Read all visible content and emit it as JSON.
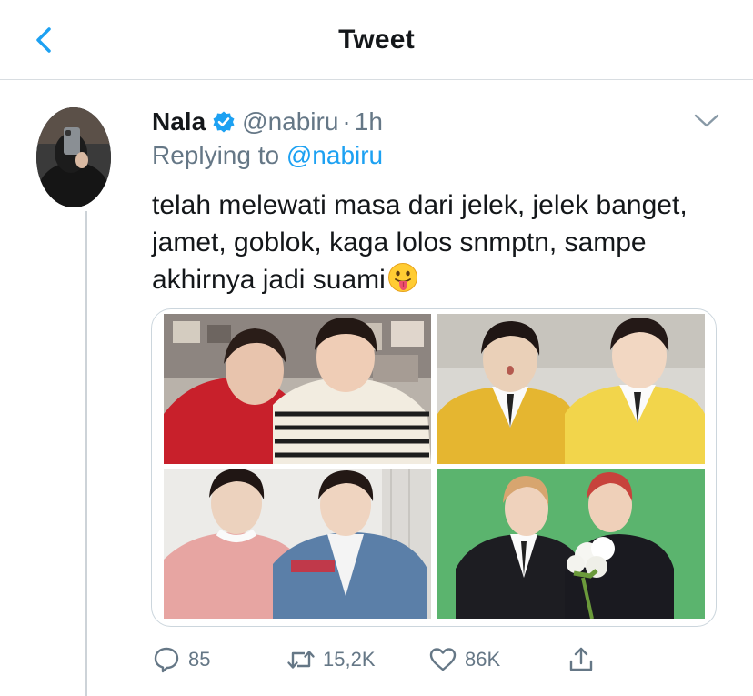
{
  "header": {
    "title": "Tweet",
    "back_icon": "chevron-left-icon"
  },
  "tweet": {
    "author_name": "Nala",
    "handle": "@nabiru",
    "separator": "·",
    "time": "1h",
    "verified": true,
    "reply_prefix": "Replying to",
    "reply_to": "@nabiru",
    "text": "telah melewati masa dari jelek, jelek banget, jamet, goblok, kaga lolos snmptn, sampe akhirnya jadi suami",
    "emoji": "face-with-tongue-emoji",
    "photos": [
      {
        "label": "photo-1"
      },
      {
        "label": "photo-2"
      },
      {
        "label": "photo-3"
      },
      {
        "label": "photo-4"
      }
    ]
  },
  "actions": {
    "replies": "85",
    "retweets": "15,2K",
    "likes": "86K",
    "share_icon": "share-icon"
  },
  "colors": {
    "accent": "#1da1f2",
    "muted": "#657786",
    "text": "#14171a",
    "divider": "#d8dde1"
  }
}
